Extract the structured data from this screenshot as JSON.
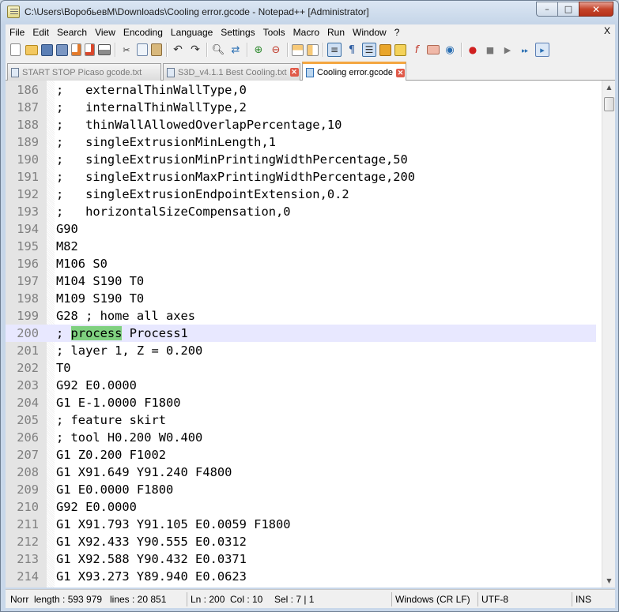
{
  "window": {
    "title": "C:\\Users\\ВоробьевМ\\Downloads\\Cooling error.gcode - Notepad++ [Administrator]",
    "minimize": "–",
    "maximize": "□",
    "close": "✕"
  },
  "menu": {
    "items": [
      "File",
      "Edit",
      "Search",
      "View",
      "Encoding",
      "Language",
      "Settings",
      "Tools",
      "Macro",
      "Run",
      "Window",
      "?"
    ],
    "close_label": "X"
  },
  "toolbar": {
    "icons": [
      "new-file-icon",
      "open-file-icon",
      "save-icon",
      "save-all-icon",
      "close-file-icon",
      "close-all-icon",
      "print-icon",
      "cut-icon",
      "copy-icon",
      "paste-icon",
      "undo-icon",
      "redo-icon",
      "find-icon",
      "replace-icon",
      "zoom-in-icon",
      "zoom-out-icon",
      "sync-vertical-icon",
      "sync-horizontal-icon",
      "word-wrap-icon",
      "show-all-chars-icon",
      "indent-guide-icon",
      "user-defined-lang-icon",
      "doc-map-icon",
      "function-list-icon",
      "folder-workspace-icon",
      "monitoring-icon",
      "record-macro-icon",
      "stop-macro-icon",
      "play-macro-icon",
      "run-macro-multiple-icon",
      "save-macro-icon"
    ]
  },
  "tabs": [
    {
      "label": "START STOP Picaso gcode.txt",
      "active": false
    },
    {
      "label": "S3D_v4.1.1  Best Cooling.txt",
      "active": false
    },
    {
      "label": "Cooling error.gcode",
      "active": true
    }
  ],
  "editor": {
    "current_line": 200,
    "lines": [
      {
        "num": "186",
        "pre": ";   externalThinWallType,0",
        "hl": "",
        "post": ""
      },
      {
        "num": "187",
        "pre": ";   internalThinWallType,2",
        "hl": "",
        "post": ""
      },
      {
        "num": "188",
        "pre": ";   thinWallAllowedOverlapPercentage,10",
        "hl": "",
        "post": ""
      },
      {
        "num": "189",
        "pre": ";   singleExtrusionMinLength,1",
        "hl": "",
        "post": ""
      },
      {
        "num": "190",
        "pre": ";   singleExtrusionMinPrintingWidthPercentage,50",
        "hl": "",
        "post": ""
      },
      {
        "num": "191",
        "pre": ";   singleExtrusionMaxPrintingWidthPercentage,200",
        "hl": "",
        "post": ""
      },
      {
        "num": "192",
        "pre": ";   singleExtrusionEndpointExtension,0.2",
        "hl": "",
        "post": ""
      },
      {
        "num": "193",
        "pre": ";   horizontalSizeCompensation,0",
        "hl": "",
        "post": ""
      },
      {
        "num": "194",
        "pre": "G90",
        "hl": "",
        "post": ""
      },
      {
        "num": "195",
        "pre": "M82",
        "hl": "",
        "post": ""
      },
      {
        "num": "196",
        "pre": "M106 S0",
        "hl": "",
        "post": ""
      },
      {
        "num": "197",
        "pre": "M104 S190 T0",
        "hl": "",
        "post": ""
      },
      {
        "num": "198",
        "pre": "M109 S190 T0",
        "hl": "",
        "post": ""
      },
      {
        "num": "199",
        "pre": "G28 ; home all axes",
        "hl": "",
        "post": ""
      },
      {
        "num": "200",
        "pre": "; ",
        "hl": "process",
        "post": " Process1"
      },
      {
        "num": "201",
        "pre": "; layer 1, Z = 0.200",
        "hl": "",
        "post": ""
      },
      {
        "num": "202",
        "pre": "T0",
        "hl": "",
        "post": ""
      },
      {
        "num": "203",
        "pre": "G92 E0.0000",
        "hl": "",
        "post": ""
      },
      {
        "num": "204",
        "pre": "G1 E-1.0000 F1800",
        "hl": "",
        "post": ""
      },
      {
        "num": "205",
        "pre": "; feature skirt",
        "hl": "",
        "post": ""
      },
      {
        "num": "206",
        "pre": "; tool H0.200 W0.400",
        "hl": "",
        "post": ""
      },
      {
        "num": "207",
        "pre": "G1 Z0.200 F1002",
        "hl": "",
        "post": ""
      },
      {
        "num": "208",
        "pre": "G1 X91.649 Y91.240 F4800",
        "hl": "",
        "post": ""
      },
      {
        "num": "209",
        "pre": "G1 E0.0000 F1800",
        "hl": "",
        "post": ""
      },
      {
        "num": "210",
        "pre": "G92 E0.0000",
        "hl": "",
        "post": ""
      },
      {
        "num": "211",
        "pre": "G1 X91.793 Y91.105 E0.0059 F1800",
        "hl": "",
        "post": ""
      },
      {
        "num": "212",
        "pre": "G1 X92.433 Y90.555 E0.0312",
        "hl": "",
        "post": ""
      },
      {
        "num": "213",
        "pre": "G1 X92.588 Y90.432 E0.0371",
        "hl": "",
        "post": ""
      },
      {
        "num": "214",
        "pre": "G1 X93.273 Y89.940 E0.0623",
        "hl": "",
        "post": ""
      }
    ]
  },
  "status": {
    "lang": "Norr",
    "length": "length : 593 979",
    "lines": "lines : 20 851",
    "ln": "Ln : 200",
    "col": "Col : 10",
    "sel": "Sel : 7 | 1",
    "eol": "Windows (CR LF)",
    "encoding": "UTF-8",
    "mode": "INS"
  },
  "colors": {
    "highlight": "#7fd07f",
    "current_line_bg": "#e8e8ff",
    "line_number_fg": "#808080"
  }
}
